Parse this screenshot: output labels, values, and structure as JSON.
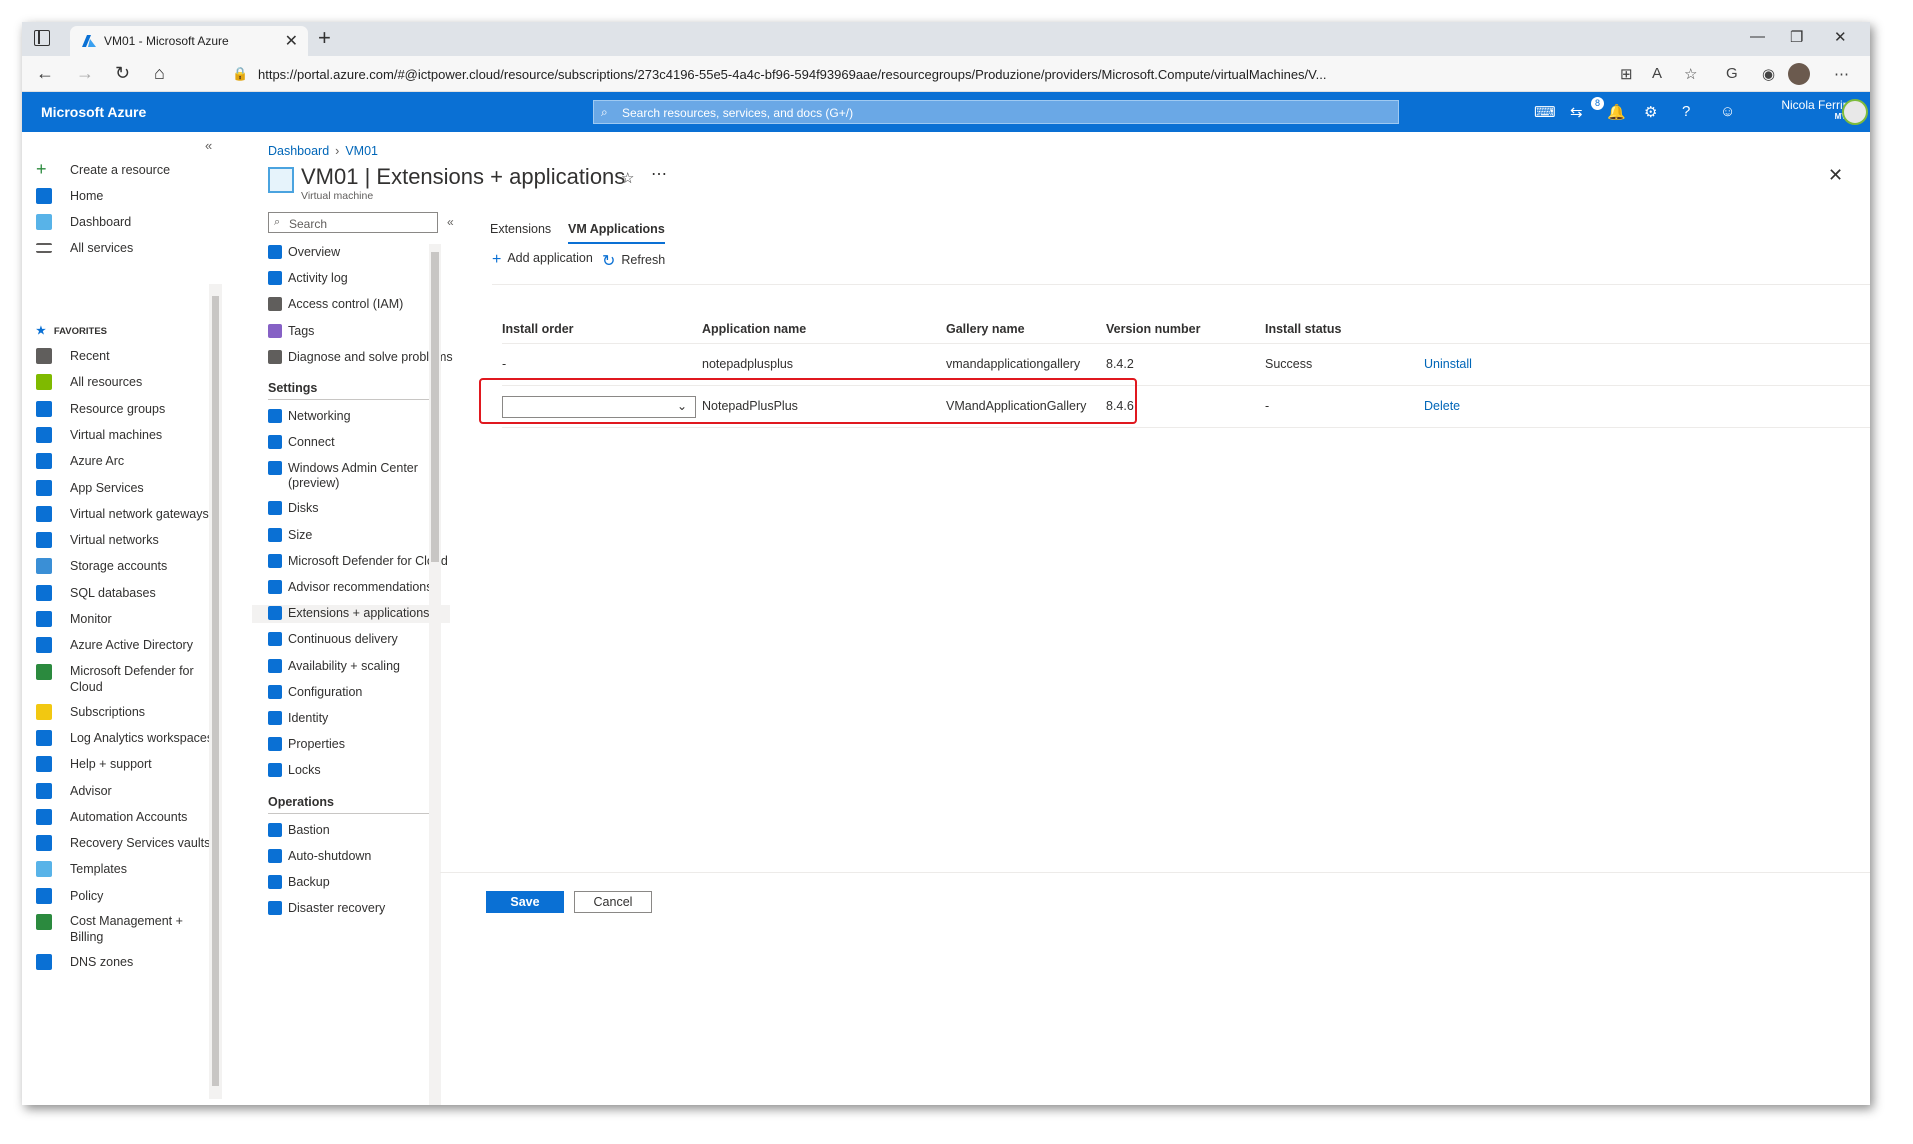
{
  "browser": {
    "tab_title": "VM01 - Microsoft Azure",
    "url": "https://portal.azure.com/#@ictpower.cloud/resource/subscriptions/273c4196-55e5-4a4c-bf96-594f93969aae/resourcegroups/Produzione/providers/Microsoft.Compute/virtualMachines/V..."
  },
  "header": {
    "brand": "Microsoft Azure",
    "search_placeholder": "Search resources, services, and docs (G+/)",
    "notifications_count": "8",
    "user_name": "Nicola Ferrini",
    "user_badge": "MVP"
  },
  "portal_nav": {
    "create": "Create a resource",
    "home": "Home",
    "dashboard": "Dashboard",
    "all_services": "All services",
    "favorites": "FAVORITES",
    "items": [
      "Recent",
      "All resources",
      "Resource groups",
      "Virtual machines",
      "Azure Arc",
      "App Services",
      "Virtual network gateways",
      "Virtual networks",
      "Storage accounts",
      "SQL databases",
      "Monitor",
      "Azure Active Directory",
      "Microsoft Defender for Cloud",
      "Subscriptions",
      "Log Analytics workspaces",
      "Help + support",
      "Advisor",
      "Automation Accounts",
      "Recovery Services vaults",
      "Templates",
      "Policy",
      "Cost Management + Billing",
      "DNS zones"
    ]
  },
  "breadcrumb": [
    "Dashboard",
    "VM01"
  ],
  "resource": {
    "title": "VM01 | Extensions + applications",
    "subtitle": "Virtual machine"
  },
  "menu": {
    "search_placeholder": "Search",
    "top": [
      "Overview",
      "Activity log",
      "Access control (IAM)",
      "Tags",
      "Diagnose and solve problems"
    ],
    "settings_header": "Settings",
    "settings": [
      "Networking",
      "Connect",
      "Windows Admin Center (preview)",
      "Disks",
      "Size",
      "Microsoft Defender for Cloud",
      "Advisor recommendations",
      "Extensions + applications",
      "Continuous delivery",
      "Availability + scaling",
      "Configuration",
      "Identity",
      "Properties",
      "Locks"
    ],
    "operations_header": "Operations",
    "operations": [
      "Bastion",
      "Auto-shutdown",
      "Backup",
      "Disaster recovery"
    ]
  },
  "tabs": [
    "Extensions",
    "VM Applications"
  ],
  "commands": {
    "add": "Add application",
    "refresh": "Refresh"
  },
  "table": {
    "headers": [
      "Install order",
      "Application name",
      "Gallery name",
      "Version number",
      "Install status"
    ],
    "rows": [
      {
        "order": "-",
        "app": "notepadplusplus",
        "gallery": "vmandapplicationgallery",
        "version": "8.4.2",
        "status": "Success",
        "action": "Uninstall"
      },
      {
        "order": "",
        "app": "NotepadPlusPlus",
        "gallery": "VMandApplicationGallery",
        "version": "8.4.6",
        "status": "-",
        "action": "Delete"
      }
    ]
  },
  "footer": {
    "save": "Save",
    "cancel": "Cancel"
  },
  "colors": {
    "azure_blue": "#0a70d4",
    "highlight": "#e0181f"
  }
}
